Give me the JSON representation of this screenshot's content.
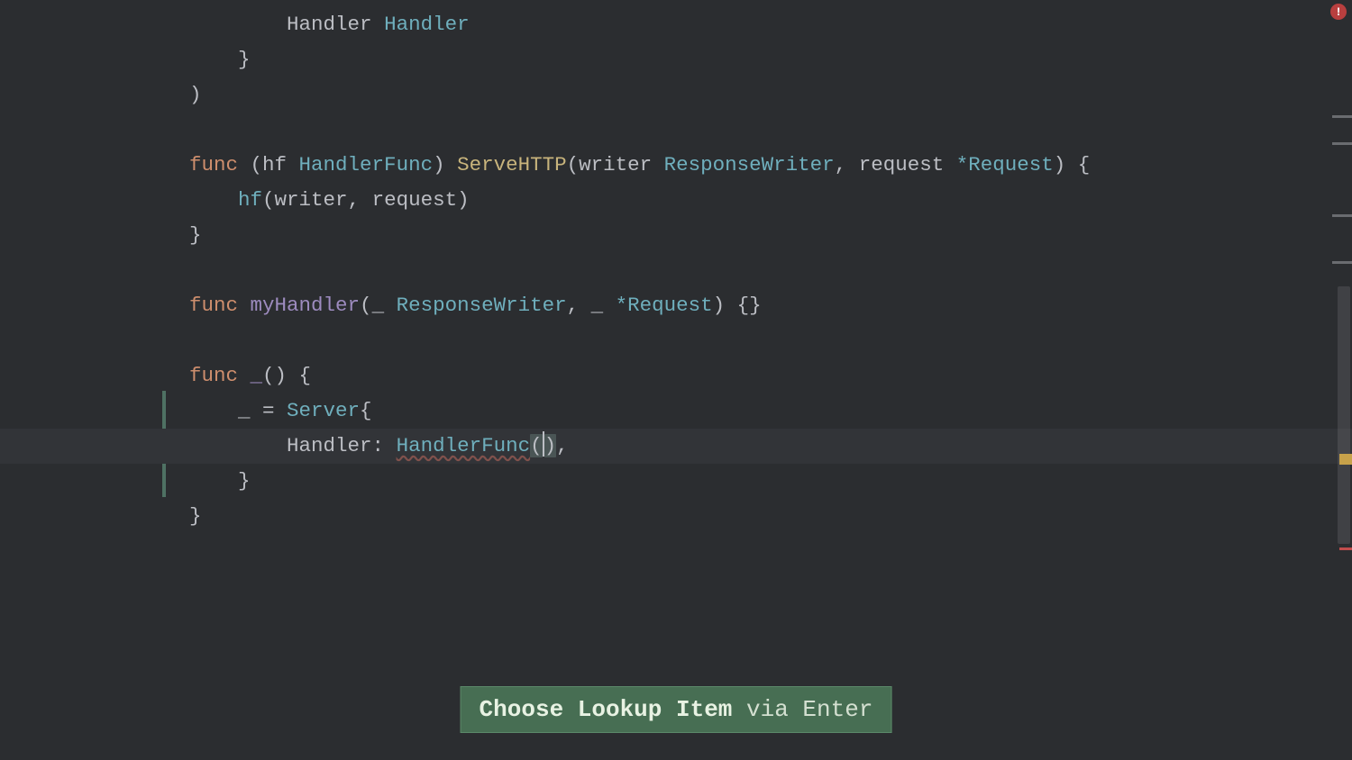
{
  "code": {
    "l1_ind": "        ",
    "l1_field": "Handler ",
    "l1_type": "Handler",
    "l2_ind": "    ",
    "l2_brace": "}",
    "l3_paren": ")",
    "l4_kw": "func ",
    "l4_open": "(",
    "l4_recv": "hf ",
    "l4_recvtype": "HandlerFunc",
    "l4_close": ") ",
    "l4_method": "ServeHTTP",
    "l4_paren_open": "(",
    "l4_p1": "writer ",
    "l4_p1t": "ResponseWriter",
    "l4_comma": ", ",
    "l4_p2": "request ",
    "l4_p2t": "*Request",
    "l4_paren_close_brace": ") {",
    "l5_ind": "    ",
    "l5_call": "hf",
    "l5_args_open": "(",
    "l5_a1": "writer",
    "l5_comma": ", ",
    "l5_a2": "request",
    "l5_close": ")",
    "l6_brace": "}",
    "l7_kw": "func ",
    "l7_name": "myHandler",
    "l7_open": "(",
    "l7_u1": "_ ",
    "l7_t1": "ResponseWriter",
    "l7_c": ", ",
    "l7_u2": "_ ",
    "l7_t2": "*Request",
    "l7_close": ") {}",
    "l8_kw": "func ",
    "l8_name": "_",
    "l8_rest": "() {",
    "l9_ind": "    ",
    "l9_assign": "_ = ",
    "l9_type": "Server",
    "l9_brace": "{",
    "l10_ind": "        ",
    "l10_field": "Handler: ",
    "l10_hf": "HandlerFunc",
    "l10_open": "(",
    "l10_close": ")",
    "l10_comma": ",",
    "l11_ind": "    ",
    "l11_brace": "}",
    "l12_brace": "}"
  },
  "tooltip": {
    "strong": "Choose Lookup Item",
    "rest": " via Enter"
  },
  "errorIcon": "!",
  "colors": {
    "bg": "#2b2d30",
    "keyword": "#ce8e6d",
    "type": "#6fafbd",
    "method": "#c8b47c",
    "tooltipBg": "#476e53"
  }
}
